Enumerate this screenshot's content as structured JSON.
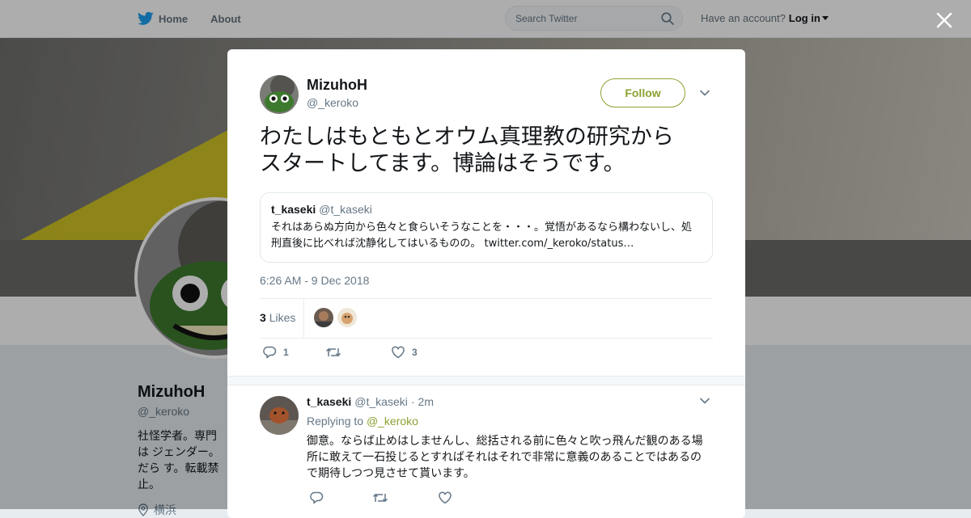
{
  "nav": {
    "home_label": "Home",
    "about_label": "About",
    "search_placeholder": "Search Twitter",
    "account_text": "Have an account?",
    "login_label": "Log in"
  },
  "profile": {
    "name": "MizuhoH",
    "handle": "@_keroko",
    "bio": "社怪学者。専門は ジェンダー。だら す。転載禁止。",
    "location": "横浜"
  },
  "tweet": {
    "author_name": "MizuhoH",
    "author_handle": "@_keroko",
    "follow_label": "Follow",
    "text_line1": "わたしはもともとオウム真理教の研究から",
    "text_line2": "スタートしてます。博論はそうです。",
    "quote": {
      "name": "t_kaseki",
      "handle": "@t_kaseki",
      "text": "それはあらぬ方向から色々と食らいそうなことを・・・。覚悟があるなら構わないし、処刑直後に比べれば沈静化してはいるものの。",
      "link": "twitter.com/_keroko/status…"
    },
    "timestamp": "6:26 AM - 9 Dec 2018",
    "likes_count": "3",
    "likes_label": "Likes",
    "reply_count": "1",
    "like_count": "3"
  },
  "reply": {
    "name": "t_kaseki",
    "handle": "@t_kaseki",
    "separator": "·",
    "time": "2m",
    "replying_prefix": "Replying to",
    "replying_to": "@_keroko",
    "text": "御意。ならば止めはしませんし、総括される前に色々と吹っ飛んだ観のある場所に敢えて一石投じるとすればそれはそれで非常に意義のあることではあるので期待しつつ見させて貰います。"
  },
  "colors": {
    "accent": "#8ba232",
    "twitter_blue": "#1da1f2",
    "muted": "#657786"
  },
  "icons": [
    "twitter-bird-icon",
    "search-icon",
    "close-icon",
    "chevron-down-icon",
    "reply-icon",
    "retweet-icon",
    "heart-icon",
    "location-pin-icon"
  ]
}
